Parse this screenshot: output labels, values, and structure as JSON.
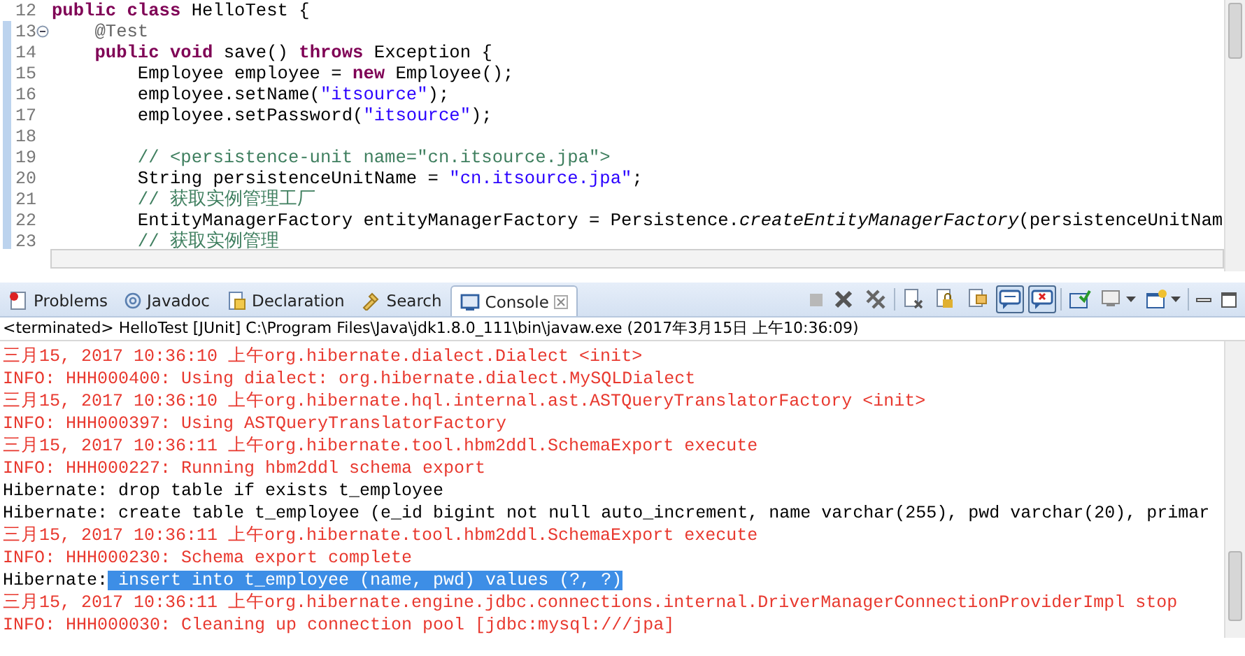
{
  "editor": {
    "lines": [
      {
        "number": "12",
        "marked": false,
        "fold": false,
        "kind": "code",
        "text": "**public class** HelloTest {"
      },
      {
        "number": "13",
        "marked": true,
        "fold": true,
        "kind": "annotation",
        "text": "    @Test"
      },
      {
        "number": "14",
        "marked": true,
        "fold": false,
        "kind": "code",
        "text": "    **public void** save() **throws** Exception {"
      },
      {
        "number": "15",
        "marked": true,
        "fold": false,
        "kind": "code",
        "text": "        Employee employee = **new** Employee();"
      },
      {
        "number": "16",
        "marked": true,
        "fold": false,
        "kind": "code",
        "text": "        employee.setName(\"itsource\");"
      },
      {
        "number": "17",
        "marked": true,
        "fold": false,
        "kind": "code",
        "text": "        employee.setPassword(\"itsource\");"
      },
      {
        "number": "18",
        "marked": true,
        "fold": false
      },
      {
        "number": "19",
        "marked": true,
        "fold": false,
        "kind": "comment",
        "text": "        // <persistence-unit name=\"cn.itsource.jpa\">"
      },
      {
        "number": "20",
        "marked": true,
        "fold": false,
        "kind": "code",
        "text": "        String persistenceUnitName = \"cn.itsource.jpa\";"
      },
      {
        "number": "21",
        "marked": true,
        "fold": false,
        "kind": "comment",
        "text": "        // 获取实例管理工厂"
      },
      {
        "number": "22",
        "marked": true,
        "fold": false,
        "kind": "code",
        "text": "        EntityManagerFactory entityManagerFactory = Persistence.*createEntityManagerFactory*(persistenceUnitNam"
      },
      {
        "number": "23",
        "marked": true,
        "fold": false,
        "kind": "comment",
        "text": "        // 获取实例管理"
      }
    ]
  },
  "tabs": [
    {
      "label": "Problems",
      "selected": false
    },
    {
      "label": "Javadoc",
      "selected": false
    },
    {
      "label": "Declaration",
      "selected": false
    },
    {
      "label": "Search",
      "selected": false
    },
    {
      "label": "Console",
      "selected": true
    }
  ],
  "toolbar": [
    {
      "pressed": false
    },
    {
      "pressed": false
    },
    {
      "pressed": false
    },
    {
      "pressed": false
    },
    {
      "pressed": false
    },
    {
      "pressed": false
    },
    {
      "pressed": true
    },
    {
      "pressed": true
    },
    {
      "pressed": false
    },
    {
      "pressed": false
    },
    {
      "pressed": false
    },
    {
      "pressed": false
    },
    {
      "pressed": false
    }
  ],
  "console": {
    "header": "<terminated> HelloTest [JUnit] C:\\Program Files\\Java\\jdk1.8.0_111\\bin\\javaw.exe (2017年3月15日 上午10:36:09)",
    "lines": [
      {
        "kind": "err",
        "text": "三月15, 2017 10:36:10 上午org.hibernate.dialect.Dialect <init>"
      },
      {
        "kind": "err",
        "text": "INFO: HHH000400: Using dialect: org.hibernate.dialect.MySQLDialect"
      },
      {
        "kind": "err",
        "text": "三月15, 2017 10:36:10 上午org.hibernate.hql.internal.ast.ASTQueryTranslatorFactory <init>"
      },
      {
        "kind": "err",
        "text": "INFO: HHH000397: Using ASTQueryTranslatorFactory"
      },
      {
        "kind": "err",
        "text": "三月15, 2017 10:36:11 上午org.hibernate.tool.hbm2ddl.SchemaExport execute"
      },
      {
        "kind": "err",
        "text": "INFO: HHH000227: Running hbm2ddl schema export"
      },
      {
        "kind": "out",
        "text": "Hibernate: drop table if exists t_employee"
      },
      {
        "kind": "out",
        "text": "Hibernate: create table t_employee (e_id bigint not null auto_increment, name varchar(255), pwd varchar(20), primar"
      },
      {
        "kind": "err",
        "text": "三月15, 2017 10:36:11 上午org.hibernate.tool.hbm2ddl.SchemaExport execute"
      },
      {
        "kind": "err",
        "text": "INFO: HHH000230: Schema export complete"
      },
      {
        "kind": "out",
        "text": "Hibernate:",
        "selection": " insert into t_employee (name, pwd) values (?, ?)"
      },
      {
        "kind": "err",
        "text": "三月15, 2017 10:36:11 上午org.hibernate.engine.jdbc.connections.internal.DriverManagerConnectionProviderImpl stop"
      },
      {
        "kind": "err",
        "text": "INFO: HHH000030: Cleaning up connection pool [jdbc:mysql:///jpa]"
      }
    ]
  }
}
